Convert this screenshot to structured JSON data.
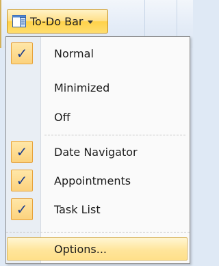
{
  "ribbon": {
    "todo_bar_label": "To-Do Bar"
  },
  "menu": {
    "items": [
      {
        "label": "Normal",
        "checked": true
      },
      {
        "label": "Minimized",
        "checked": false
      },
      {
        "label": "Off",
        "checked": false
      },
      {
        "label": "Date Navigator",
        "checked": true
      },
      {
        "label": "Appointments",
        "checked": true
      },
      {
        "label": "Task List",
        "checked": true
      }
    ],
    "options_label": "Options...",
    "check_glyph": "✓"
  },
  "colors": {
    "accent_highlight": "#ffe08a",
    "check_border": "#e7a23a",
    "check_mark": "#1a3c8c",
    "menu_gutter": "#e9eef4"
  },
  "icons": {
    "todo_bar": "todo-bar-icon",
    "dropdown": "chevron-down-icon",
    "check": "checkmark-icon"
  }
}
